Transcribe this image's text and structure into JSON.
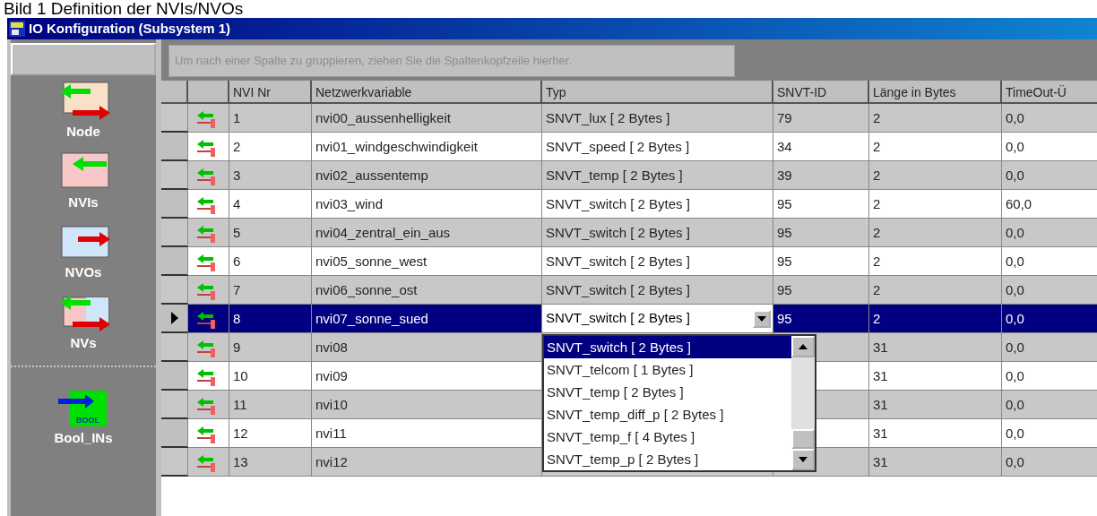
{
  "caption": "Bild 1 Definition der NVIs/NVOs",
  "window": {
    "title": "IO Konfiguration (Subsystem 1)"
  },
  "sidebar": {
    "items": [
      {
        "label": "Node",
        "kind": "node"
      },
      {
        "label": "NVIs",
        "kind": "nvi"
      },
      {
        "label": "NVOs",
        "kind": "nvo"
      },
      {
        "label": "NVs",
        "kind": "nv"
      },
      {
        "label": "Bool_INs",
        "kind": "bool",
        "badge": "BOOL"
      }
    ]
  },
  "group_panel": {
    "text": "Um nach einer Spalte zu gruppieren, ziehen Sie die Spaltenkopfzeile hierher."
  },
  "table": {
    "columns": [
      "NVI Nr",
      "Netzwerkvariable",
      "Typ",
      "SNVT-ID",
      "Länge in Bytes",
      "TimeOut-Ü"
    ],
    "rows": [
      {
        "nr": "1",
        "name": "nvi00_aussenhelligkeit",
        "typ": "SNVT_lux  [ 2 Bytes ]",
        "snvt_id": "79",
        "laenge": "2",
        "timeout": "0,0",
        "selected": false
      },
      {
        "nr": "2",
        "name": "nvi01_windgeschwindigkeit",
        "typ": "SNVT_speed  [ 2 Bytes ]",
        "snvt_id": "34",
        "laenge": "2",
        "timeout": "0,0",
        "selected": false
      },
      {
        "nr": "3",
        "name": "nvi02_aussentemp",
        "typ": "SNVT_temp  [ 2 Bytes ]",
        "snvt_id": "39",
        "laenge": "2",
        "timeout": "0,0",
        "selected": false
      },
      {
        "nr": "4",
        "name": "nvi03_wind",
        "typ": "SNVT_switch  [ 2 Bytes ]",
        "snvt_id": "95",
        "laenge": "2",
        "timeout": "60,0",
        "selected": false
      },
      {
        "nr": "5",
        "name": "nvi04_zentral_ein_aus",
        "typ": "SNVT_switch  [ 2 Bytes ]",
        "snvt_id": "95",
        "laenge": "2",
        "timeout": "0,0",
        "selected": false
      },
      {
        "nr": "6",
        "name": "nvi05_sonne_west",
        "typ": "SNVT_switch  [ 2 Bytes ]",
        "snvt_id": "95",
        "laenge": "2",
        "timeout": "0,0",
        "selected": false
      },
      {
        "nr": "7",
        "name": "nvi06_sonne_ost",
        "typ": "SNVT_switch  [ 2 Bytes ]",
        "snvt_id": "95",
        "laenge": "2",
        "timeout": "0,0",
        "selected": false
      },
      {
        "nr": "8",
        "name": "nvi07_sonne_sued",
        "typ": "SNVT_switch  [ 2 Bytes ]",
        "snvt_id": "95",
        "laenge": "2",
        "timeout": "0,0",
        "selected": true,
        "editing": true
      },
      {
        "nr": "9",
        "name": "nvi08",
        "laenge": "31",
        "timeout": "0,0",
        "selected": false
      },
      {
        "nr": "10",
        "name": "nvi09",
        "laenge": "31",
        "timeout": "0,0",
        "selected": false
      },
      {
        "nr": "11",
        "name": "nvi10",
        "laenge": "31",
        "timeout": "0,0",
        "selected": false
      },
      {
        "nr": "12",
        "name": "nvi11",
        "laenge": "31",
        "timeout": "0,0",
        "selected": false
      },
      {
        "nr": "13",
        "name": "nvi12",
        "laenge": "31",
        "timeout": "0,0",
        "selected": false
      }
    ]
  },
  "dropdown": {
    "options": [
      {
        "label": "SNVT_switch  [ 2 Bytes ]",
        "selected": true
      },
      {
        "label": "SNVT_telcom  [ 1 Bytes ]",
        "selected": false
      },
      {
        "label": "SNVT_temp  [ 2 Bytes ]",
        "selected": false
      },
      {
        "label": "SNVT_temp_diff_p  [ 2 Bytes ]",
        "selected": false
      },
      {
        "label": "SNVT_temp_f  [ 4 Bytes ]",
        "selected": false
      },
      {
        "label": "SNVT_temp_p  [ 2 Bytes ]",
        "selected": false
      }
    ]
  }
}
